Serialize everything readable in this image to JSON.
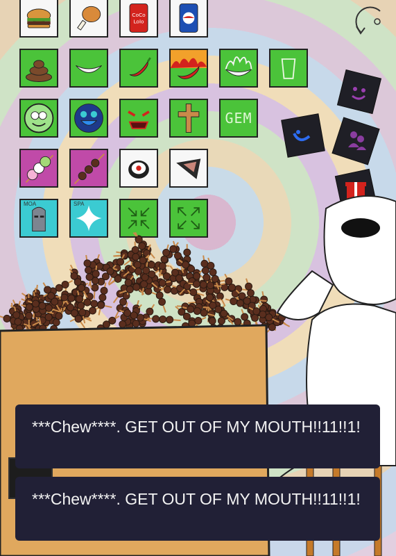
{
  "hud": {
    "restart_icon": "restart-icon"
  },
  "inventory": {
    "rows": [
      [
        {
          "id": "burger",
          "icon": "burger-icon",
          "bg": "#f7f7f7"
        },
        {
          "id": "drumstick",
          "icon": "drumstick-icon",
          "bg": "#f7f7f7"
        },
        {
          "id": "cola",
          "icon": "cola-can-icon",
          "bg": "#f7f7f7",
          "label": "CoCo Lolo"
        },
        {
          "id": "soda",
          "icon": "soda-can-icon",
          "bg": "#f7f7f7"
        }
      ],
      [
        {
          "id": "poop",
          "icon": "poop-icon",
          "bg": "#4bc33a"
        },
        {
          "id": "smile",
          "icon": "smile-icon",
          "bg": "#4bc33a"
        },
        {
          "id": "pepper",
          "icon": "chili-pepper-icon",
          "bg": "#4bc33a"
        },
        {
          "id": "fire-pepper",
          "icon": "flaming-pepper-icon",
          "bg": "#4bc33a"
        },
        {
          "id": "flame-smile",
          "icon": "flame-smile-icon",
          "bg": "#4bc33a"
        },
        {
          "id": "cup",
          "icon": "cup-icon",
          "bg": "#4bc33a"
        }
      ],
      [
        {
          "id": "melon-face",
          "icon": "melon-face-icon",
          "bg": "#4bc33a"
        },
        {
          "id": "blue-face",
          "icon": "blue-face-icon",
          "bg": "#4bc33a"
        },
        {
          "id": "demon-face",
          "icon": "demon-face-icon",
          "bg": "#4bc33a"
        },
        {
          "id": "cross",
          "icon": "cross-icon",
          "bg": "#4bc33a"
        },
        {
          "id": "gem",
          "icon": "gem-text-icon",
          "bg": "#4bc33a",
          "label": "GEM"
        }
      ],
      [
        {
          "id": "dango",
          "icon": "dango-icon",
          "bg": "#c04aa8"
        },
        {
          "id": "skewer",
          "icon": "skewer-icon",
          "bg": "#c04aa8"
        },
        {
          "id": "sushi",
          "icon": "sushi-icon",
          "bg": "#f7f7f7"
        },
        {
          "id": "onigiri",
          "icon": "onigiri-icon",
          "bg": "#f7f7f7"
        }
      ],
      [
        {
          "id": "moai",
          "icon": "moai-icon",
          "bg": "#3bcbd2",
          "label": "MOA"
        },
        {
          "id": "sparkle",
          "icon": "sparkle-icon",
          "bg": "#3bcbd2",
          "label": "SPA"
        },
        {
          "id": "shrink",
          "icon": "shrink-arrows-icon",
          "bg": "#4bc33a"
        },
        {
          "id": "expand",
          "icon": "expand-arrows-icon",
          "bg": "#4bc33a"
        }
      ]
    ]
  },
  "floating_cards": [
    {
      "icon": "purple-smile-card-icon"
    },
    {
      "icon": "blue-face-card-icon"
    },
    {
      "icon": "purple-figures-card-icon"
    },
    {
      "icon": "red-gift-card-icon"
    }
  ],
  "dialogs": [
    {
      "text": "***Chew****. GET OUT OF MY MOUTH!!11!!1!"
    },
    {
      "text": "***Chew****. GET OUT OF MY MOUTH!!11!!1!"
    }
  ],
  "colors": {
    "dialog_bg": "#212036",
    "dialog_text": "#f3f3f3",
    "counter": "#e0a85e",
    "green_tile": "#4bc33a"
  }
}
